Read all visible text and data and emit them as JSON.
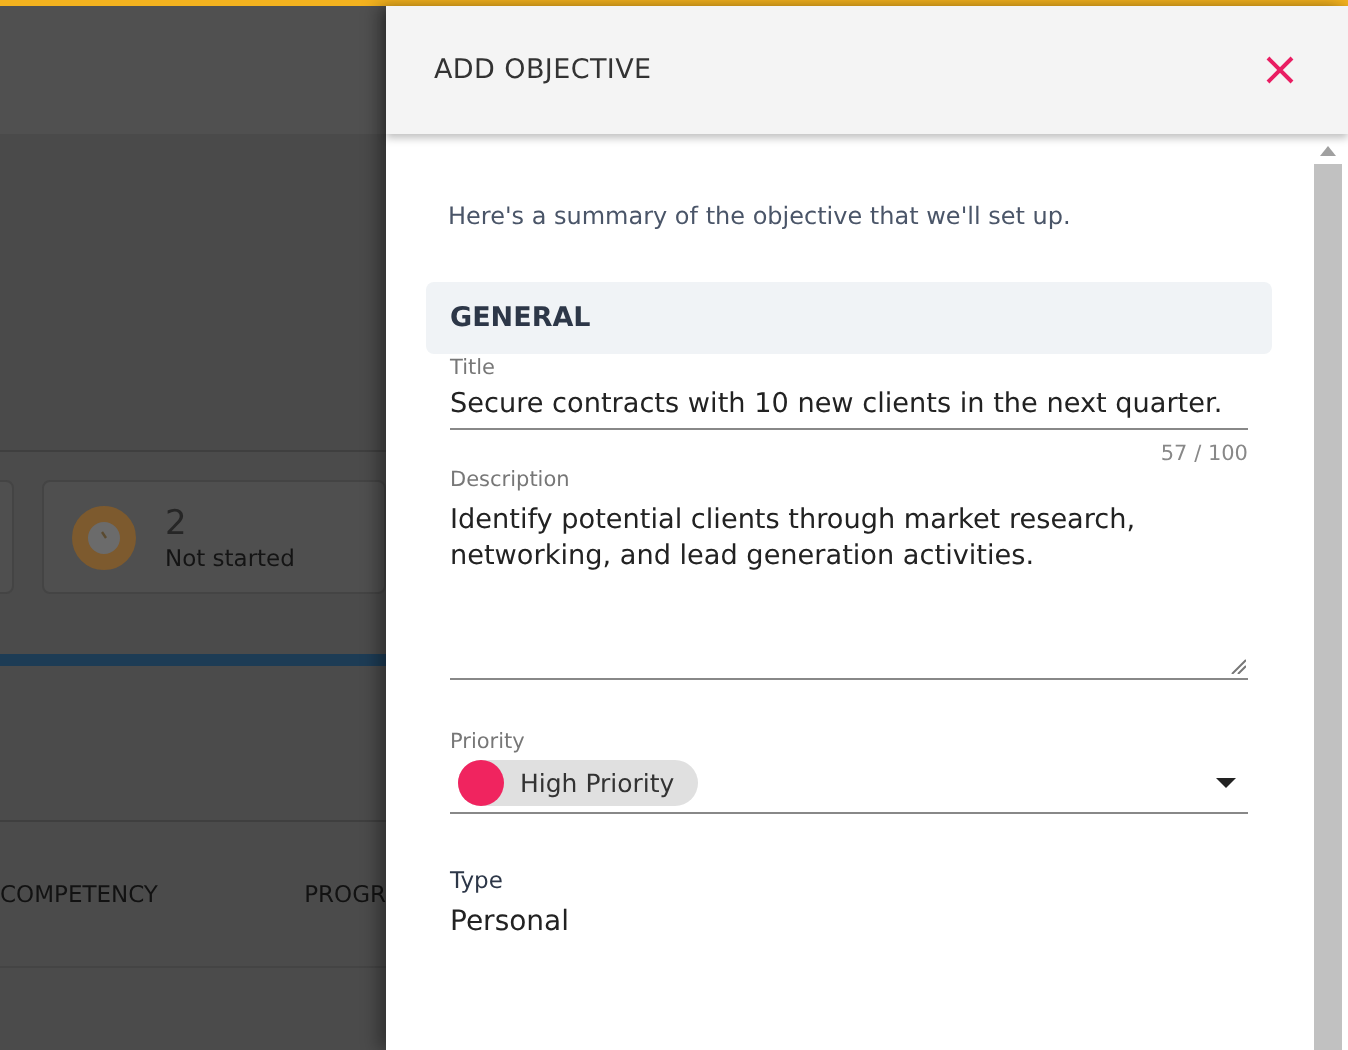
{
  "background": {
    "stat_cards": [
      {
        "value": "2",
        "label": "Not started"
      }
    ],
    "table": {
      "columns": [
        "COMPETENCY",
        "PROGR"
      ]
    }
  },
  "panel": {
    "title": "ADD OBJECTIVE",
    "intro": "Here's a summary of the objective that we'll set up.",
    "section": "GENERAL",
    "fields": [
      {
        "kind": "text",
        "label": "Title",
        "value": "Secure contracts with 10 new clients in the next quarter.",
        "counter": "57 / 100"
      },
      {
        "kind": "textarea",
        "label": "Description",
        "value": "Identify potential clients through market research,\nnetworking, and lead generation activities."
      },
      {
        "kind": "select",
        "label": "Priority",
        "value": "High Priority",
        "color": "#f0245f"
      },
      {
        "kind": "static",
        "label": "Type",
        "value": "Personal"
      }
    ]
  }
}
